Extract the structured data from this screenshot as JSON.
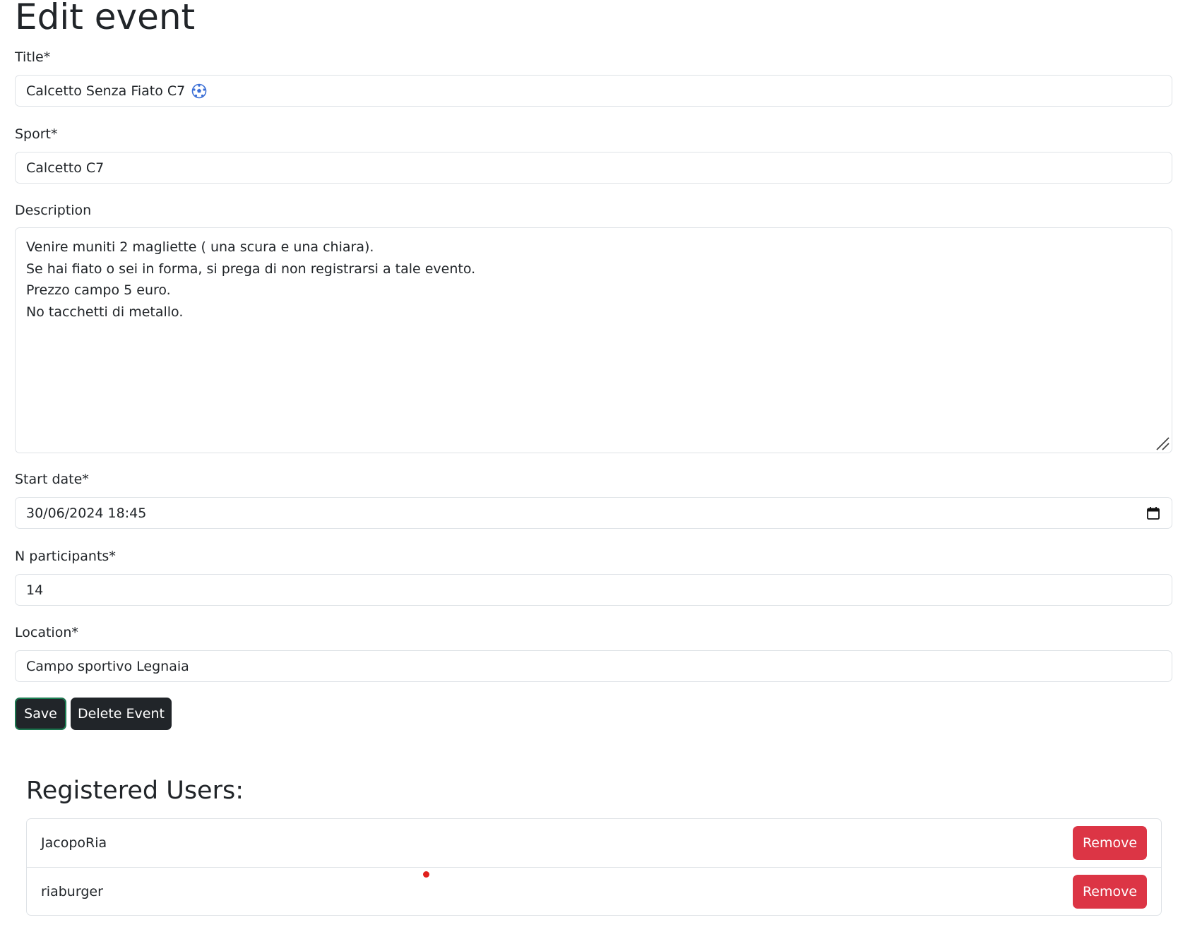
{
  "page": {
    "title": "Edit event"
  },
  "form": {
    "title": {
      "label": "Title*",
      "value": "Calcetto Senza Fiato C7",
      "icon": "soccer-ball-icon"
    },
    "sport": {
      "label": "Sport*",
      "value": "Calcetto C7"
    },
    "description": {
      "label": "Description",
      "lines": [
        "Venire muniti 2 magliette ( una scura e una chiara).",
        "Se hai fiato o sei in forma, si prega di non registrarsi a tale evento.",
        "Prezzo campo 5 euro.",
        "No tacchetti di metallo."
      ]
    },
    "start_date": {
      "label": "Start date*",
      "value": "30/06/2024 18:45",
      "icon": "calendar-icon"
    },
    "participants": {
      "label": "N participants*",
      "value": "14"
    },
    "location": {
      "label": "Location*",
      "value": "Campo sportivo Legnaia"
    },
    "save_label": "Save",
    "delete_label": "Delete Event"
  },
  "registered": {
    "heading": "Registered Users:",
    "users": [
      {
        "name": "JacopoRia",
        "action": "Remove"
      },
      {
        "name": "riaburger",
        "action": "Remove"
      }
    ]
  },
  "colors": {
    "primary_dark": "#212529",
    "danger": "#dc3545",
    "border": "#dee2e6",
    "cursor_dot": "#e0201c"
  }
}
